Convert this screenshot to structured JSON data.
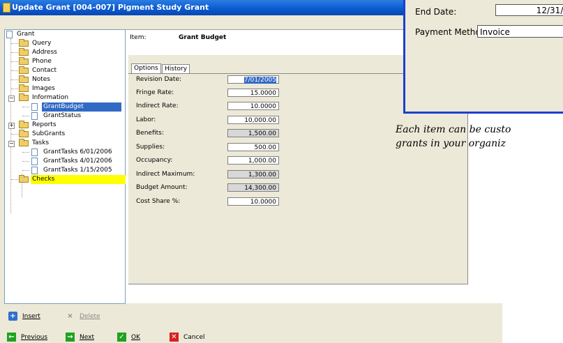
{
  "window": {
    "title": "Update Grant [004-007] Pigment Study Grant"
  },
  "tree": {
    "root": "Grant",
    "nodes": {
      "query": "Query",
      "address": "Address",
      "phone": "Phone",
      "contact": "Contact",
      "notes": "Notes",
      "images": "Images",
      "information": "Information",
      "grant_budget": "GrantBudget",
      "grant_status": "GrantStatus",
      "reports": "Reports",
      "subgrants": "SubGrants",
      "tasks": "Tasks",
      "task_1": "GrantTasks 6/01/2006",
      "task_2": "GrantTasks 4/01/2006",
      "task_3": "GrantTasks 1/15/2005",
      "checks": "Checks"
    }
  },
  "detail": {
    "item_label": "Item:",
    "item_value": "Grant Budget",
    "tabs": [
      "Options",
      "History"
    ],
    "fields": {
      "revision_date": {
        "label": "Revision Date:",
        "value": "7/01/2005"
      },
      "fringe_rate": {
        "label": "Fringe Rate:",
        "value": "15.0000"
      },
      "indirect_rate": {
        "label": "Indirect Rate:",
        "value": "10.0000"
      },
      "labor": {
        "label": "Labor:",
        "value": "10,000.00"
      },
      "benefits": {
        "label": "Benefits:",
        "value": "1,500.00"
      },
      "supplies": {
        "label": "Supplies:",
        "value": "500.00"
      },
      "occupancy": {
        "label": "Occupancy:",
        "value": "1,000.00"
      },
      "indirect_maximum": {
        "label": "Indirect Maximum:",
        "value": "1,300.00"
      },
      "budget_amount": {
        "label": "Budget Amount:",
        "value": "14,300.00"
      },
      "cost_share": {
        "label": "Cost Share %:",
        "value": "10.0000"
      }
    }
  },
  "buttons": {
    "insert": "Insert",
    "delete": "Delete",
    "previous": "Previous",
    "next": "Next",
    "ok": "OK",
    "cancel": "Cancel"
  },
  "inset": {
    "end_date_label": "End Date:",
    "end_date_value": "12/31/2",
    "payment_label": "Payment Metho",
    "payment_value": "Invoice"
  },
  "caption": {
    "line1": "Each item can be custo",
    "line2": "grants in your organiz"
  },
  "colors": {
    "selection": "#316ac5",
    "highlight": "#ffff00",
    "frame": "#1c3fd0"
  }
}
